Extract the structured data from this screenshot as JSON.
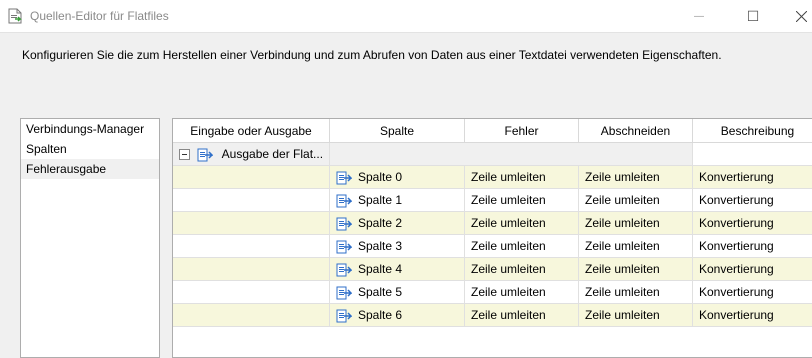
{
  "window": {
    "title": "Quellen-Editor für Flatfiles",
    "minimize_glyph": "—",
    "maximize_glyph": "☐"
  },
  "description": "Konfigurieren Sie die zum Herstellen einer Verbindung und zum Abrufen von Daten aus einer Textdatei verwendeten Eigenschaften.",
  "nav": {
    "items": [
      {
        "label": "Verbindungs-Manager"
      },
      {
        "label": "Spalten"
      },
      {
        "label": "Fehlerausgabe",
        "selected": true
      }
    ]
  },
  "grid": {
    "headers": [
      "Eingabe oder Ausgabe",
      "Spalte",
      "Fehler",
      "Abschneiden",
      "Beschreibung"
    ],
    "output_group": "Ausgabe der Flat...",
    "rows": [
      {
        "spalte": "Spalte 0",
        "fehler": "Zeile umleiten",
        "abschneiden": "Zeile umleiten",
        "beschreibung": "Konvertierung"
      },
      {
        "spalte": "Spalte 1",
        "fehler": "Zeile umleiten",
        "abschneiden": "Zeile umleiten",
        "beschreibung": "Konvertierung"
      },
      {
        "spalte": "Spalte 2",
        "fehler": "Zeile umleiten",
        "abschneiden": "Zeile umleiten",
        "beschreibung": "Konvertierung"
      },
      {
        "spalte": "Spalte 3",
        "fehler": "Zeile umleiten",
        "abschneiden": "Zeile umleiten",
        "beschreibung": "Konvertierung"
      },
      {
        "spalte": "Spalte 4",
        "fehler": "Zeile umleiten",
        "abschneiden": "Zeile umleiten",
        "beschreibung": "Konvertierung"
      },
      {
        "spalte": "Spalte 5",
        "fehler": "Zeile umleiten",
        "abschneiden": "Zeile umleiten",
        "beschreibung": "Konvertierung"
      },
      {
        "spalte": "Spalte 6",
        "fehler": "Zeile umleiten",
        "abschneiden": "Zeile umleiten",
        "beschreibung": "Konvertierung"
      }
    ]
  },
  "colors": {
    "row_highlight": "#f7f7dc",
    "icon_blue": "#2f6fc9"
  },
  "icons": {
    "title": "flatfile-source-icon",
    "column": "column-icon",
    "output": "output-icon"
  }
}
